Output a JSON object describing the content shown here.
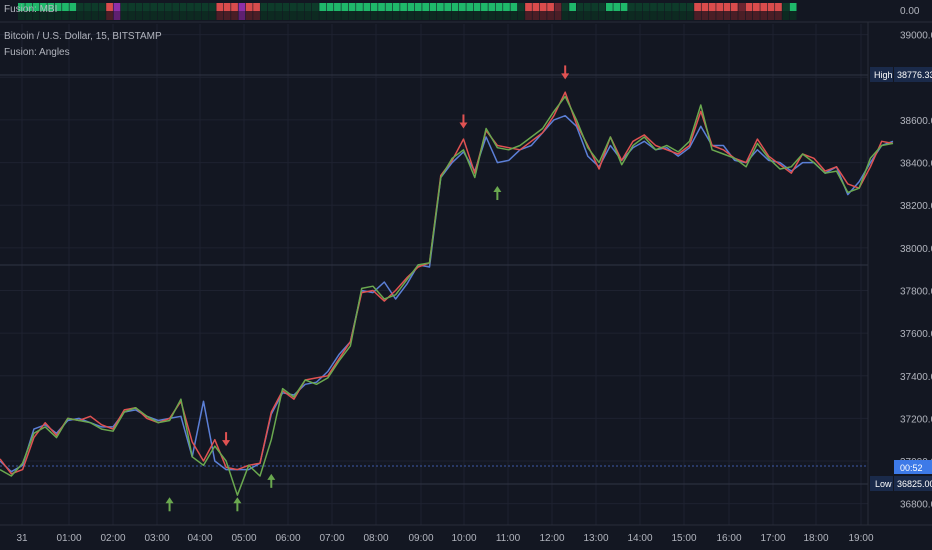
{
  "header": {
    "pane_title": "Fusion: MBI",
    "symbol_title": "Bitcoin / U.S. Dollar, 15, BITSTAMP",
    "indicator_title": "Fusion: Angles"
  },
  "colors": {
    "background": "#131722",
    "grid": "#1e2230",
    "axis_text": "#b2b5be",
    "red": "#e05252",
    "green": "#6aa84f",
    "blue": "#5b7fd6",
    "mbi_strong_green": "#1fb86a",
    "mbi_dark_green": "#0e3b2a",
    "mbi_red": "#d94c4c",
    "mbi_dark_red": "#6b2530",
    "mbi_purple": "#8e2fa8",
    "current_price_bg": "#3d7ae8",
    "marker_bg": "#1a2a4a"
  },
  "mbi": {
    "axis_label": "0.00",
    "cells": [
      "g",
      "g",
      "g",
      "g",
      "g",
      "g",
      "g",
      "g",
      "d",
      "d",
      "d",
      "d",
      "r",
      "p",
      "d",
      "d",
      "d",
      "d",
      "d",
      "d",
      "d",
      "d",
      "d",
      "d",
      "d",
      "d",
      "d",
      "r",
      "r",
      "r",
      "p",
      "r",
      "r",
      "d",
      "d",
      "d",
      "d",
      "d",
      "d",
      "d",
      "d",
      "g",
      "g",
      "g",
      "g",
      "g",
      "g",
      "g",
      "g",
      "g",
      "g",
      "g",
      "g",
      "g",
      "g",
      "g",
      "g",
      "g",
      "g",
      "g",
      "g",
      "g",
      "g",
      "g",
      "g",
      "g",
      "g",
      "g",
      "d",
      "r",
      "r",
      "r",
      "r",
      "x",
      "d",
      "g",
      "d",
      "d",
      "d",
      "d",
      "g",
      "g",
      "g",
      "d",
      "d",
      "d",
      "d",
      "d",
      "d",
      "d",
      "d",
      "d",
      "r",
      "r",
      "r",
      "r",
      "r",
      "r",
      "x",
      "r",
      "r",
      "r",
      "r",
      "r",
      "d",
      "g"
    ]
  },
  "axis": {
    "price_labels": [
      "39000.00",
      "38800.00",
      "38600.00",
      "38400.00",
      "38200.00",
      "38000.00",
      "37800.00",
      "37600.00",
      "37400.00",
      "37200.00",
      "37000.00",
      "36800.00"
    ],
    "time_labels": [
      "31",
      "01:00",
      "02:00",
      "03:00",
      "04:00",
      "05:00",
      "06:00",
      "07:00",
      "08:00",
      "09:00",
      "10:00",
      "11:00",
      "12:00",
      "13:00",
      "14:00",
      "15:00",
      "16:00",
      "17:00",
      "18:00",
      "19:00"
    ],
    "high_label": "High",
    "high_value": "38776.33",
    "low_label": "Low",
    "low_value": "36825.00",
    "countdown": "00:52"
  },
  "chart_data": {
    "type": "line",
    "title": "Bitcoin / U.S. Dollar, 15, BITSTAMP",
    "ylim": [
      36700,
      39050
    ],
    "x_labels": [
      "31",
      "01:00",
      "02:00",
      "03:00",
      "04:00",
      "05:00",
      "06:00",
      "07:00",
      "08:00",
      "09:00",
      "10:00",
      "11:00",
      "12:00",
      "13:00",
      "14:00",
      "15:00",
      "16:00",
      "17:00",
      "18:00",
      "19:00"
    ],
    "high": 38776.33,
    "low": 36825.0,
    "series": [
      {
        "color": "red",
        "values": [
          37010,
          36940,
          36960,
          37110,
          37180,
          37120,
          37200,
          37190,
          37210,
          37170,
          37150,
          37240,
          37250,
          37200,
          37180,
          37200,
          37280,
          37090,
          37000,
          37100,
          36970,
          36960,
          36980,
          36990,
          37230,
          37330,
          37290,
          37380,
          37390,
          37400,
          37480,
          37560,
          37790,
          37800,
          37750,
          37800,
          37860,
          37910,
          37930,
          38340,
          38410,
          38510,
          38350,
          38550,
          38480,
          38470,
          38460,
          38500,
          38540,
          38620,
          38730,
          38580,
          38480,
          38370,
          38520,
          38410,
          38500,
          38530,
          38480,
          38460,
          38440,
          38480,
          38640,
          38480,
          38460,
          38420,
          38400,
          38510,
          38430,
          38390,
          38350,
          38440,
          38420,
          38360,
          38380,
          38300,
          38280,
          38380,
          38500,
          38490
        ]
      },
      {
        "color": "green",
        "values": [
          36960,
          36930,
          36990,
          37130,
          37160,
          37110,
          37200,
          37190,
          37180,
          37150,
          37140,
          37230,
          37250,
          37210,
          37180,
          37190,
          37290,
          37020,
          36980,
          37070,
          37000,
          36840,
          36980,
          36930,
          37100,
          37340,
          37300,
          37380,
          37360,
          37390,
          37470,
          37540,
          37810,
          37820,
          37760,
          37780,
          37850,
          37920,
          37930,
          38330,
          38420,
          38460,
          38330,
          38560,
          38470,
          38460,
          38480,
          38520,
          38560,
          38640,
          38710,
          38600,
          38470,
          38400,
          38520,
          38390,
          38480,
          38520,
          38460,
          38480,
          38450,
          38500,
          38670,
          38460,
          38440,
          38420,
          38380,
          38490,
          38420,
          38370,
          38380,
          38440,
          38400,
          38350,
          38360,
          38260,
          38280,
          38420,
          38480,
          38490
        ]
      },
      {
        "color": "blue",
        "values": [
          37000,
          36950,
          36980,
          37150,
          37170,
          37130,
          37190,
          37200,
          37180,
          37160,
          37160,
          37230,
          37240,
          37210,
          37190,
          37200,
          37210,
          37020,
          37280,
          37000,
          36960,
          36960,
          36960,
          36990,
          37220,
          37320,
          37310,
          37360,
          37370,
          37420,
          37500,
          37560,
          37800,
          37790,
          37840,
          37760,
          37830,
          37920,
          37910,
          38330,
          38400,
          38450,
          38360,
          38520,
          38400,
          38410,
          38460,
          38480,
          38540,
          38600,
          38620,
          38570,
          38430,
          38380,
          38480,
          38410,
          38470,
          38500,
          38460,
          38470,
          38430,
          38470,
          38570,
          38480,
          38480,
          38410,
          38400,
          38460,
          38410,
          38400,
          38360,
          38400,
          38400,
          38350,
          38380,
          38250,
          38310,
          38400,
          38480,
          38500
        ]
      }
    ],
    "down_arrows": [
      {
        "index": 20,
        "value": 37070
      },
      {
        "index": 41,
        "value": 38560
      },
      {
        "index": 50,
        "value": 38790
      }
    ],
    "up_arrows": [
      {
        "index": 15,
        "value": 36830
      },
      {
        "index": 21,
        "value": 36830
      },
      {
        "index": 24,
        "value": 36940
      },
      {
        "index": 44,
        "value": 38290
      }
    ]
  }
}
